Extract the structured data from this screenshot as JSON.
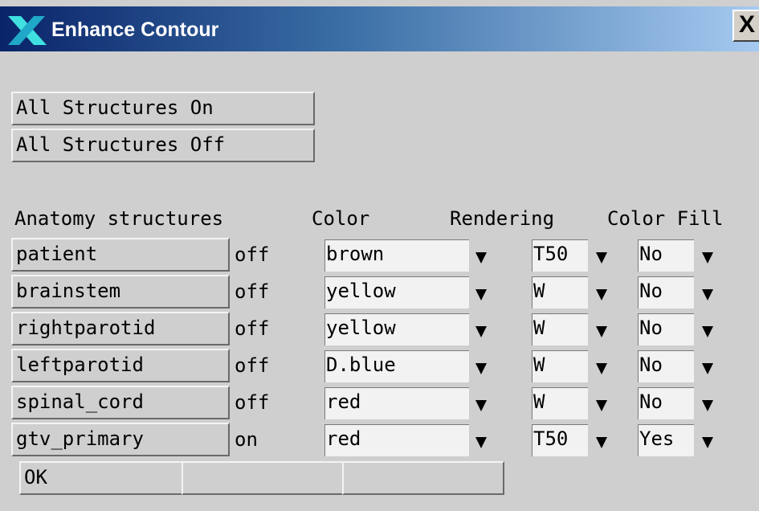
{
  "window": {
    "title": "Enhance Contour",
    "close_label": "X"
  },
  "toolbar": {
    "all_on_label": "All Structures On",
    "all_off_label": "All Structures Off"
  },
  "table": {
    "headers": {
      "structures": "Anatomy structures",
      "color": "Color",
      "rendering": "Rendering",
      "color_fill": "Color Fill"
    },
    "rows": [
      {
        "name": "patient",
        "state": "off",
        "color": "brown",
        "rendering": "T50",
        "fill": "No"
      },
      {
        "name": "brainstem",
        "state": "off",
        "color": "yellow",
        "rendering": "W",
        "fill": "No"
      },
      {
        "name": "rightparotid",
        "state": "off",
        "color": "yellow",
        "rendering": "W",
        "fill": "No"
      },
      {
        "name": "leftparotid",
        "state": "off",
        "color": "D.blue",
        "rendering": "W",
        "fill": "No"
      },
      {
        "name": "spinal_cord",
        "state": "off",
        "color": "red",
        "rendering": "W",
        "fill": "No"
      },
      {
        "name": "gtv_primary",
        "state": "on",
        "color": "red",
        "rendering": "T50",
        "fill": "Yes"
      }
    ]
  },
  "footer": {
    "ok_label": "OK",
    "button2_label": "",
    "button3_label": ""
  },
  "icons": {
    "app": "x-logo-icon",
    "dropdown": "triangle-down-icon"
  }
}
